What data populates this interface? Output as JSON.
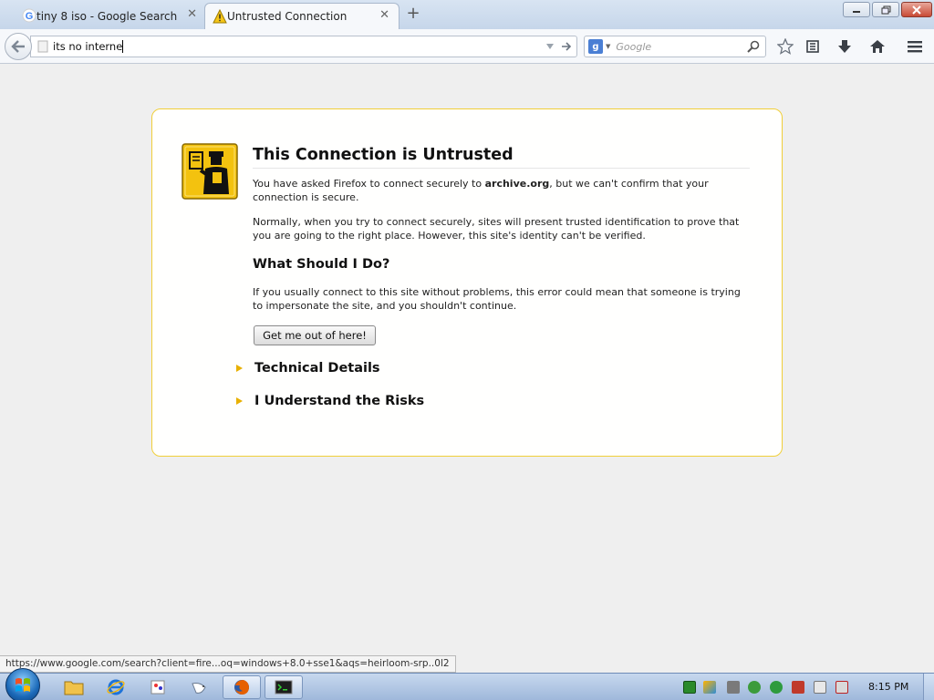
{
  "tabs": [
    {
      "label": "tiny 8 iso - Google Search",
      "icon": "google-icon",
      "active": false
    },
    {
      "label": "Untrusted Connection",
      "icon": "warning-icon",
      "active": true
    }
  ],
  "navbar": {
    "url_value": "its no interne",
    "search_placeholder": "Google",
    "search_engine_icon": "google-plus-icon"
  },
  "error_page": {
    "title": "This Connection is Untrusted",
    "p1_before": "You have asked Firefox to connect securely to ",
    "p1_host": "archive.org",
    "p1_after": ", but we can't confirm that your connection is secure.",
    "p2": "Normally, when you try to connect securely, sites will present trusted identification to prove that you are going to the right place. However, this site's identity can't be verified.",
    "what_heading": "What Should I Do?",
    "p3": "If you usually connect to this site without problems, this error could mean that someone is trying to impersonate the site, and you shouldn't continue.",
    "get_out_button": "Get me out of here!",
    "technical_details": "Technical Details",
    "understand_risks": "I Understand the Risks"
  },
  "status_url": "https://www.google.com/search?client=fire...oq=windows+8.0+sse1&aqs=heirloom-srp..0l2",
  "taskbar": {
    "clock": "8:15 PM",
    "apps": [
      "explorer-icon",
      "internet-explorer-icon",
      "paint-icon",
      "bird-icon",
      "firefox-icon",
      "cmd-icon"
    ]
  },
  "colors": {
    "accent_border": "#f0cf3a",
    "expander_triangle": "#e8b000",
    "page_bg": "#efefef"
  }
}
